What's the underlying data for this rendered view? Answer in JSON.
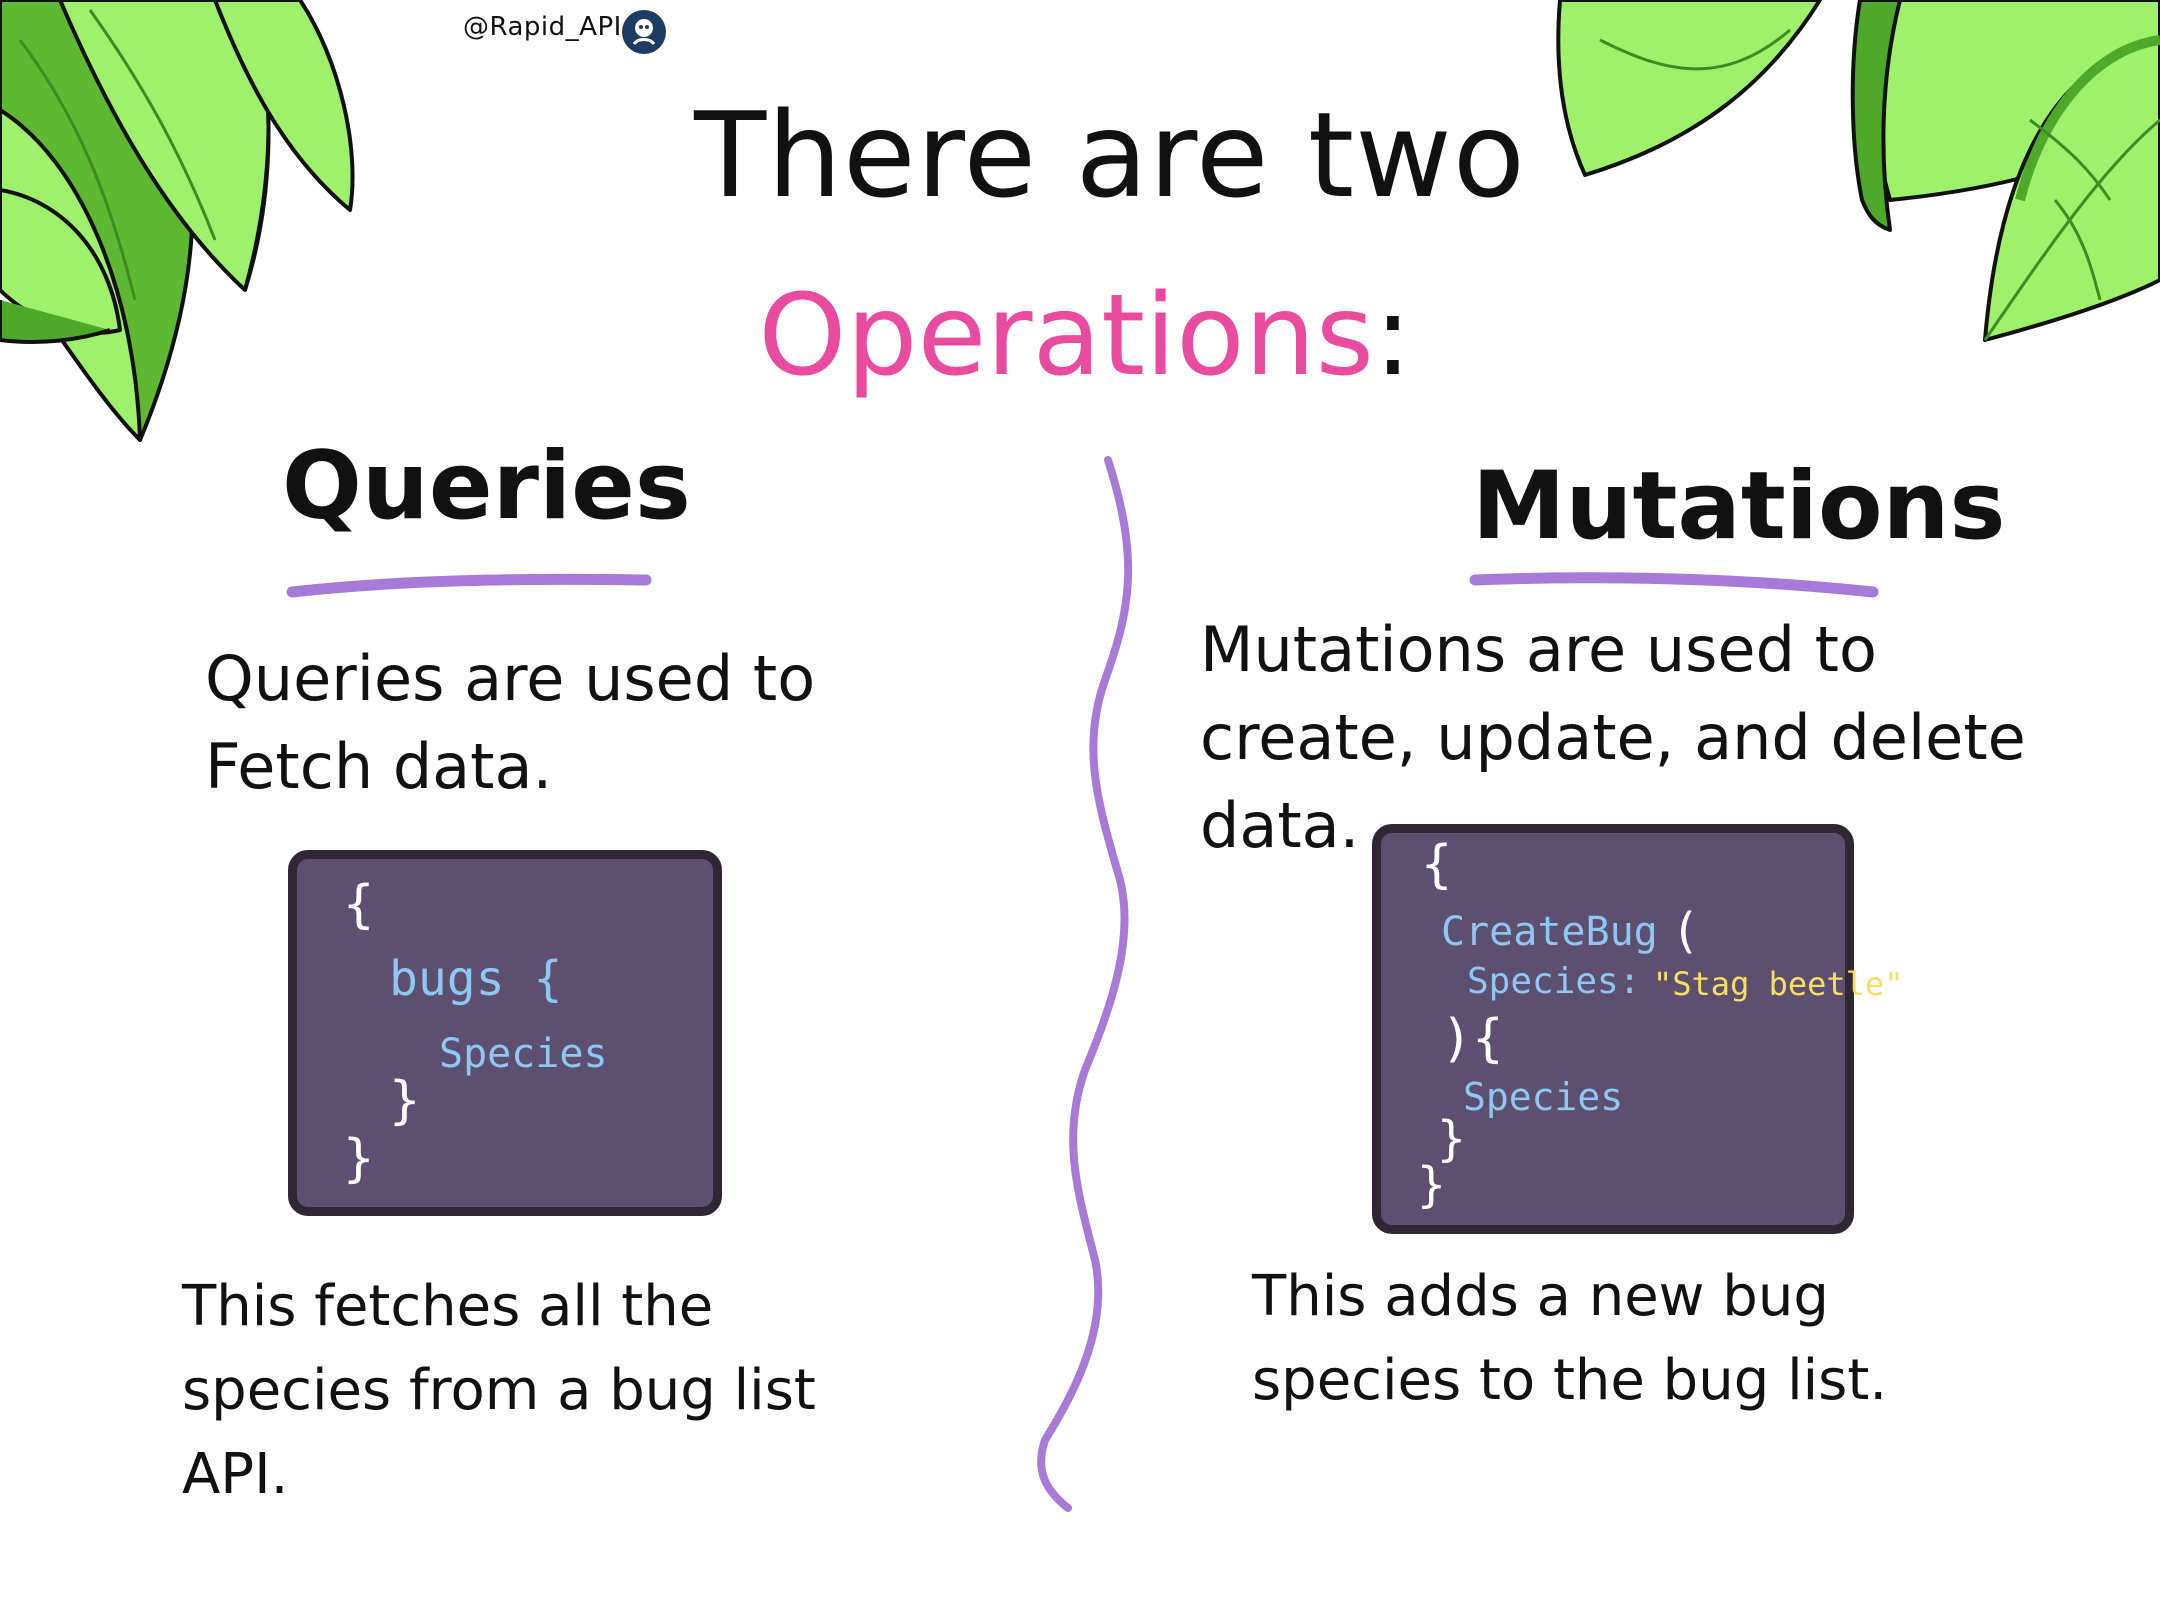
{
  "header": {
    "handle": "@Rapid_API",
    "title_line1": "There are two",
    "title_line2_word": "Operations",
    "title_line2_punct": ":"
  },
  "queries": {
    "heading": "Queries",
    "description": "Queries are used to Fetch data.",
    "code": [
      "{",
      "bugs {",
      "Species",
      "}",
      "}"
    ],
    "footer": "This fetches all the species from a bug list API."
  },
  "mutations": {
    "heading": "Mutations",
    "description": "Mutations are used to create, update, and delete data.",
    "code": {
      "open": "{",
      "call": "CreateBug",
      "call_paren": "(",
      "arg_key": "Species:",
      "arg_value": "\"Stag beetle\"",
      "close_paren": "){",
      "field": "Species",
      "close_inner": "}",
      "close_outer": "}"
    },
    "footer": "This adds a new bug species to the bug list."
  },
  "colors": {
    "accent_pink": "#e94b9f",
    "underline_purple": "#a87ad8",
    "code_bg": "#5c4f6f",
    "code_blue": "#8fc6f2",
    "code_yellow": "#f4df63",
    "leaf_light": "#9ff06a",
    "leaf_dark": "#4fa82a"
  },
  "icons": [
    "leaf-cluster-left-icon",
    "leaf-cluster-right-icon",
    "rapid-api-logo-icon",
    "wavy-divider-icon"
  ]
}
